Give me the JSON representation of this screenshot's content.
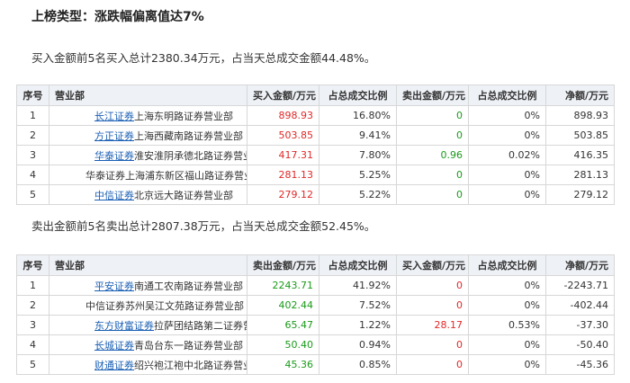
{
  "title": "上榜类型：涨跌幅偏离值达7%",
  "buy_summary": "买入金额前5名买入总计2380.34万元，占当天总成交金额44.48%。",
  "sell_summary": "卖出金额前5名卖出总计2807.38万元，占当天总成交金额52.45%。",
  "buy_table": {
    "headers": [
      "序号",
      "营业部",
      "买入金额/万元",
      "占总成交比例",
      "卖出金额/万元",
      "占总成交比例",
      "净额/万元"
    ],
    "rows": [
      {
        "no": "1",
        "link": "长江证券",
        "branch": "上海东明路证券营业部",
        "amount": "898.93",
        "ratio": "16.80%",
        "other": "0",
        "other_ratio": "0%",
        "net": "898.93"
      },
      {
        "no": "2",
        "link": "方正证券",
        "branch": "上海西藏南路证券营业部",
        "amount": "503.85",
        "ratio": "9.41%",
        "other": "0",
        "other_ratio": "0%",
        "net": "503.85"
      },
      {
        "no": "3",
        "link": "华泰证券",
        "branch": "淮安淮阴承德北路证券营业部",
        "amount": "417.31",
        "ratio": "7.80%",
        "other": "0.96",
        "other_ratio": "0.02%",
        "net": "416.35"
      },
      {
        "no": "4",
        "link": "",
        "branch": "华泰证券上海浦东新区福山路证券营业部",
        "amount": "281.13",
        "ratio": "5.25%",
        "other": "0",
        "other_ratio": "0%",
        "net": "281.13"
      },
      {
        "no": "5",
        "link": "中信证券",
        "branch": "北京远大路证券营业部",
        "amount": "279.12",
        "ratio": "5.22%",
        "other": "0",
        "other_ratio": "0%",
        "net": "279.12"
      }
    ]
  },
  "sell_table": {
    "headers": [
      "序号",
      "营业部",
      "卖出金额/万元",
      "占总成交比例",
      "买入金额/万元",
      "占总成交比例",
      "净额/万元"
    ],
    "rows": [
      {
        "no": "1",
        "link": "平安证券",
        "branch": "南通工农南路证券营业部",
        "amount": "2243.71",
        "ratio": "41.92%",
        "other": "0",
        "other_ratio": "0%",
        "net": "-2243.71"
      },
      {
        "no": "2",
        "link": "",
        "branch": "中信证券苏州吴江文苑路证券营业部",
        "amount": "402.44",
        "ratio": "7.52%",
        "other": "0",
        "other_ratio": "0%",
        "net": "-402.44"
      },
      {
        "no": "3",
        "link": "东方财富证券",
        "branch": "拉萨团结路第二证券营业部",
        "amount": "65.47",
        "ratio": "1.22%",
        "other": "28.17",
        "other_ratio": "0.53%",
        "net": "-37.30"
      },
      {
        "no": "4",
        "link": "长城证券",
        "branch": "青岛台东一路证券营业部",
        "amount": "50.40",
        "ratio": "0.94%",
        "other": "0",
        "other_ratio": "0%",
        "net": "-50.40"
      },
      {
        "no": "5",
        "link": "财通证券",
        "branch": "绍兴袍江袍中北路证券营业部",
        "amount": "45.36",
        "ratio": "0.85%",
        "other": "0",
        "other_ratio": "0%",
        "net": "-45.36"
      }
    ]
  },
  "colors": {
    "buy": "#e12828",
    "sell": "#1a9b1a",
    "link": "#1a5fb4",
    "header_bg": "#eef1f6"
  }
}
